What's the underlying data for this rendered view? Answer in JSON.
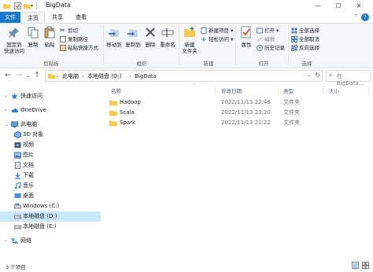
{
  "window": {
    "title": "BigData",
    "controls": {
      "minimize": "—",
      "maximize": "☐",
      "close": "✕"
    }
  },
  "tabs": {
    "file": "文件",
    "home": "主页",
    "share": "共享",
    "view": "查看"
  },
  "ribbon": {
    "clipboard": {
      "label": "剪贴板",
      "pin_quick_access": "固定到\n快速访问",
      "copy": "复制",
      "paste": "粘贴",
      "cut": "剪切",
      "copy_path": "复制路径",
      "paste_shortcut": "粘贴快捷方式"
    },
    "organize": {
      "label": "组织",
      "move_to": "移动到",
      "copy_to": "复制到",
      "delete": "删除",
      "rename": "重命名"
    },
    "new": {
      "label": "新建",
      "new_folder": "新建\n文件夹",
      "new_item": "新建项目 ▾",
      "easy_access": "轻松访问 ▾"
    },
    "open": {
      "label": "打开",
      "properties": "属性",
      "open": "打开 ▾",
      "edit": "编辑",
      "history": "历史记录"
    },
    "select": {
      "label": "选择",
      "select_all": "全部选择",
      "select_none": "全部取消",
      "invert": "反向选择"
    }
  },
  "address": {
    "back": "←",
    "forward": "→",
    "recent": "⌄",
    "up": "↑",
    "crumbs": [
      "此电脑",
      "本地磁盘 (D:)",
      "BigData"
    ],
    "separator": "›",
    "search_placeholder": "在 BigData..."
  },
  "nav": [
    {
      "label": "快速访问",
      "icon": "star-icon",
      "level": 0,
      "selected": false
    },
    {
      "label": "OneDrive",
      "icon": "cloud-icon",
      "level": 0,
      "selected": false
    },
    {
      "label": "此电脑",
      "icon": "computer-icon",
      "level": 0,
      "selected": false
    },
    {
      "label": "3D 对象",
      "icon": "cube-icon",
      "level": 1,
      "selected": false
    },
    {
      "label": "视频",
      "icon": "video-icon",
      "level": 1,
      "selected": false
    },
    {
      "label": "图片",
      "icon": "picture-icon",
      "level": 1,
      "selected": false
    },
    {
      "label": "文档",
      "icon": "document-icon",
      "level": 1,
      "selected": false
    },
    {
      "label": "下载",
      "icon": "download-icon",
      "level": 1,
      "selected": false
    },
    {
      "label": "音乐",
      "icon": "music-icon",
      "level": 1,
      "selected": false
    },
    {
      "label": "桌面",
      "icon": "desktop-icon",
      "level": 1,
      "selected": false
    },
    {
      "label": "Windows (C:)",
      "icon": "windows-drive-icon",
      "level": 1,
      "selected": false
    },
    {
      "label": "本地磁盘 (D:)",
      "icon": "drive-icon",
      "level": 1,
      "selected": true
    },
    {
      "label": "本地磁盘 (E:)",
      "icon": "drive-icon",
      "level": 1,
      "selected": false
    },
    {
      "label": "网络",
      "icon": "network-icon",
      "level": 0,
      "selected": false
    }
  ],
  "columns": {
    "name": "名称",
    "date": "修改日期",
    "type": "类型",
    "size": "大小"
  },
  "files": [
    {
      "name": "Hadoop",
      "date": "2022/11/13 22:48",
      "type": "文件夹"
    },
    {
      "name": "Scala",
      "date": "2022/11/13 23:20",
      "type": "文件夹"
    },
    {
      "name": "Spark",
      "date": "2022/11/13 21:22",
      "type": "文件夹"
    }
  ],
  "status": {
    "count": "3 个项目"
  },
  "colors": {
    "accent": "#1979ca",
    "folder": "#f8c94a",
    "selected": "#cce8ff"
  }
}
